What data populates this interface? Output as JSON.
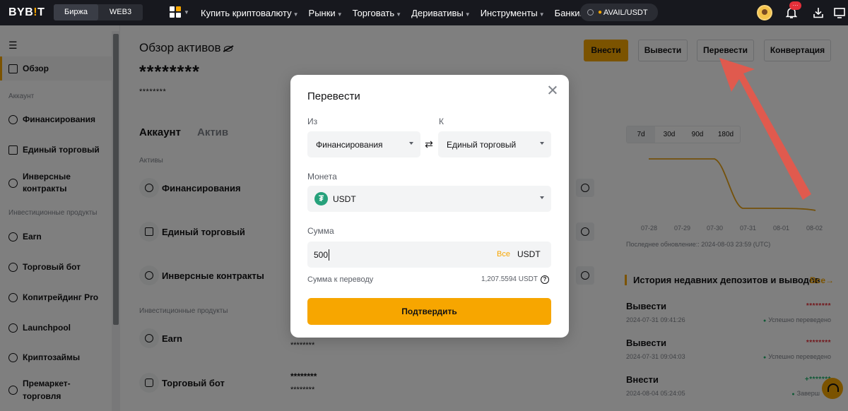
{
  "topbar": {
    "logo_a": "BYB",
    "logo_b": "!",
    "logo_c": "T",
    "exchange_tab": "Биржа",
    "web3_tab": "WEB3",
    "nav": [
      "Купить криптовалюту",
      "Рынки",
      "Торговать",
      "Деривативы",
      "Инструменты",
      "Банкинг"
    ],
    "search_text": "AVAIL/USDT",
    "notification_badge": "···"
  },
  "sidebar": {
    "overview": "Обзор",
    "section_account": "Аккаунт",
    "financing": "Финансирования",
    "unified_trading": "Единый торговый",
    "inverse_1": "Инверсные",
    "inverse_2": "контракты",
    "section_invest": "Инвестиционные продукты",
    "earn": "Earn",
    "trading_bot": "Торговый бот",
    "copytrading": "Копитрейдинг Pro",
    "launchpool": "Launchpool",
    "crypto_loans": "Криптозаймы",
    "premarket_1": "Премаркет-",
    "premarket_2": "торговля"
  },
  "main": {
    "title": "Обзор активов",
    "balance_mask": "********",
    "sub_mask": "********",
    "btn_deposit": "Внести",
    "btn_withdraw": "Вывести",
    "btn_transfer": "Перевести",
    "btn_convert": "Конвертация",
    "tab_account": "Аккаунт",
    "tab_asset": "Актив",
    "section_assets": "Активы",
    "row_financing": "Финансирования",
    "row_unified": "Единый торговый",
    "row_inverse": "Инверсные контракты",
    "section_invest": "Инвестиционные продукты",
    "row_earn": "Earn",
    "row_bot": "Торговый бот",
    "mask_a": "********",
    "mask_b": "********",
    "mask_c": "********"
  },
  "chart_panel": {
    "periods": [
      "7d",
      "30d",
      "90d",
      "180d"
    ],
    "dates": [
      "07-28",
      "07-29",
      "07-30",
      "07-31",
      "08-01",
      "08-02"
    ],
    "updated": "Последнее обновление:: 2024-08-03 23:59 (UTC)",
    "line_color": "#e8a317"
  },
  "history": {
    "title": "История недавних депозитов и выводов",
    "all": "Все",
    "rows": [
      {
        "type": "Вывести",
        "amount": "********",
        "time": "2024-07-31 09:41:26",
        "status": "Успешно переведено"
      },
      {
        "type": "Вывести",
        "amount": "********",
        "time": "2024-07-31 09:04:03",
        "status": "Успешно переведено"
      },
      {
        "type": "Внести",
        "amount": "+*******",
        "time": "2024-08-04 05:24:05",
        "status": "Заверш"
      }
    ]
  },
  "modal": {
    "title": "Перевести",
    "from_label": "Из",
    "to_label": "К",
    "from_value": "Финансирования",
    "to_value": "Единый торговый",
    "coin_label": "Монета",
    "coin_symbol": "₮",
    "coin_value": "USDT",
    "amount_label": "Сумма",
    "amount_value": "500",
    "amount_all": "Все",
    "amount_currency": "USDT",
    "transfer_label": "Сумма к переводу",
    "transfer_value": "1,207.5594 USDT",
    "help": "?",
    "confirm": "Подтвердить"
  },
  "colors": {
    "accent": "#f7a600",
    "topbar": "#17181e",
    "arrow": "#e8574a"
  }
}
